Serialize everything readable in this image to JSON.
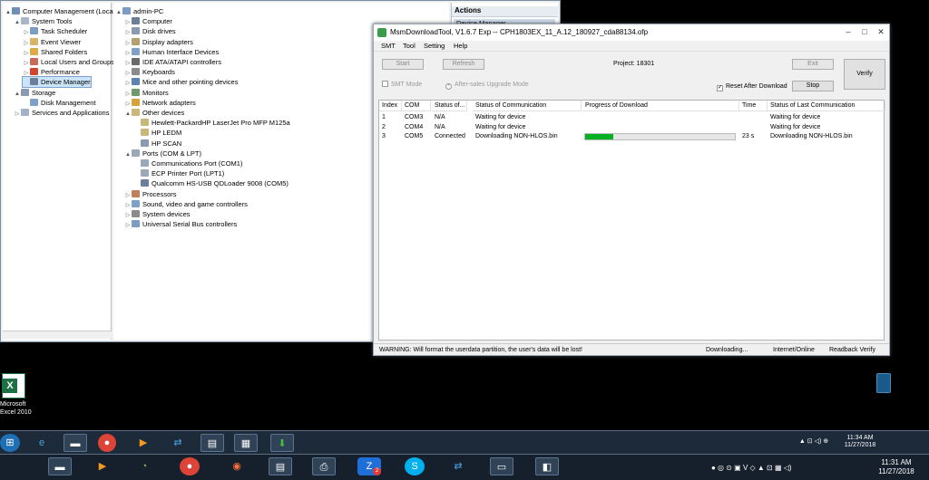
{
  "computer_management": {
    "left_tree": [
      {
        "label": "Computer Management (Local",
        "indent": 0,
        "toggle": "▲"
      },
      {
        "label": "System Tools",
        "indent": 1,
        "toggle": "▲"
      },
      {
        "label": "Task Scheduler",
        "indent": 2,
        "toggle": "▷"
      },
      {
        "label": "Event Viewer",
        "indent": 2,
        "toggle": "▷"
      },
      {
        "label": "Shared Folders",
        "indent": 2,
        "toggle": "▷"
      },
      {
        "label": "Local Users and Groups",
        "indent": 2,
        "toggle": "▷"
      },
      {
        "label": "Performance",
        "indent": 2,
        "toggle": "▷"
      },
      {
        "label": "Device Manager",
        "indent": 2,
        "toggle": "",
        "selected": true
      },
      {
        "label": "Storage",
        "indent": 1,
        "toggle": "▲"
      },
      {
        "label": "Disk Management",
        "indent": 2,
        "toggle": ""
      },
      {
        "label": "Services and Applications",
        "indent": 1,
        "toggle": "▷"
      }
    ],
    "device_tree": [
      {
        "label": "admin-PC",
        "indent": 0,
        "toggle": "▲"
      },
      {
        "label": "Computer",
        "indent": 1,
        "toggle": "▷"
      },
      {
        "label": "Disk drives",
        "indent": 1,
        "toggle": "▷"
      },
      {
        "label": "Display adapters",
        "indent": 1,
        "toggle": "▷"
      },
      {
        "label": "Human Interface Devices",
        "indent": 1,
        "toggle": "▷"
      },
      {
        "label": "IDE ATA/ATAPI controllers",
        "indent": 1,
        "toggle": "▷"
      },
      {
        "label": "Keyboards",
        "indent": 1,
        "toggle": "▷"
      },
      {
        "label": "Mice and other pointing devices",
        "indent": 1,
        "toggle": "▷"
      },
      {
        "label": "Monitors",
        "indent": 1,
        "toggle": "▷"
      },
      {
        "label": "Network adapters",
        "indent": 1,
        "toggle": "▷"
      },
      {
        "label": "Other devices",
        "indent": 1,
        "toggle": "▲"
      },
      {
        "label": "Hewlett-PackardHP LaserJet Pro MFP M125a",
        "indent": 2,
        "toggle": ""
      },
      {
        "label": "HP LEDM",
        "indent": 2,
        "toggle": ""
      },
      {
        "label": "HP SCAN",
        "indent": 2,
        "toggle": ""
      },
      {
        "label": "Ports (COM & LPT)",
        "indent": 1,
        "toggle": "▲"
      },
      {
        "label": "Communications Port (COM1)",
        "indent": 2,
        "toggle": ""
      },
      {
        "label": "ECP Printer Port (LPT1)",
        "indent": 2,
        "toggle": ""
      },
      {
        "label": "Qualcomm HS-USB QDLoader 9008 (COM5)",
        "indent": 2,
        "toggle": ""
      },
      {
        "label": "Processors",
        "indent": 1,
        "toggle": "▷"
      },
      {
        "label": "Sound, video and game controllers",
        "indent": 1,
        "toggle": "▷"
      },
      {
        "label": "System devices",
        "indent": 1,
        "toggle": "▷"
      },
      {
        "label": "Universal Serial Bus controllers",
        "indent": 1,
        "toggle": "▷"
      }
    ],
    "actions_header": "Actions",
    "actions_item": "Device Manager"
  },
  "msm": {
    "title": "MsmDownloadTool, V1.6.7 Exp -- CPH1803EX_11_A.12_180927_cda88134.ofp",
    "menu": [
      "SMT",
      "Tool",
      "Setting",
      "Help"
    ],
    "start": "Start",
    "refresh": "Refresh",
    "project": "Project: 18301",
    "exit": "Exit",
    "verify": "Verify",
    "stop": "Stop",
    "smt_mode": "SMT Mode",
    "after_sales": "After-sales Upgrade Mode",
    "reset_after": "Reset After Download",
    "columns": [
      "Index",
      "COM",
      "Status of...",
      "Status of Communication",
      "Progress of Download",
      "Time",
      "Status of Last Communication"
    ],
    "rows": [
      {
        "index": "1",
        "com": "COM3",
        "status": "N/A",
        "comm": "Waiting for device",
        "progress": null,
        "time": "",
        "last": "Waiting for device"
      },
      {
        "index": "2",
        "com": "COM4",
        "status": "N/A",
        "comm": "Waiting for device",
        "progress": null,
        "time": "",
        "last": "Waiting for device"
      },
      {
        "index": "3",
        "com": "COM5",
        "status": "Connected",
        "comm": "Downloading NON-HLOS.bin",
        "progress": 0.19,
        "time": "23 s",
        "last": "Downloading NON-HLOS.bin"
      }
    ],
    "status_warning": "WARNING: Will format the userdata partition, the user's data will be lost!",
    "status_downloading": "Downloading...",
    "status_online": "Internet/Online",
    "status_readback": "Readback Verify"
  },
  "desktop": {
    "excel_line1": "Microsoft",
    "excel_line2": "Excel 2010"
  },
  "taskbar1": {
    "time": "11:34 AM",
    "date": "11/27/2018"
  },
  "taskbar2": {
    "time": "11:31 AM",
    "date": "11/27/2018",
    "zalo_badge": "2"
  }
}
